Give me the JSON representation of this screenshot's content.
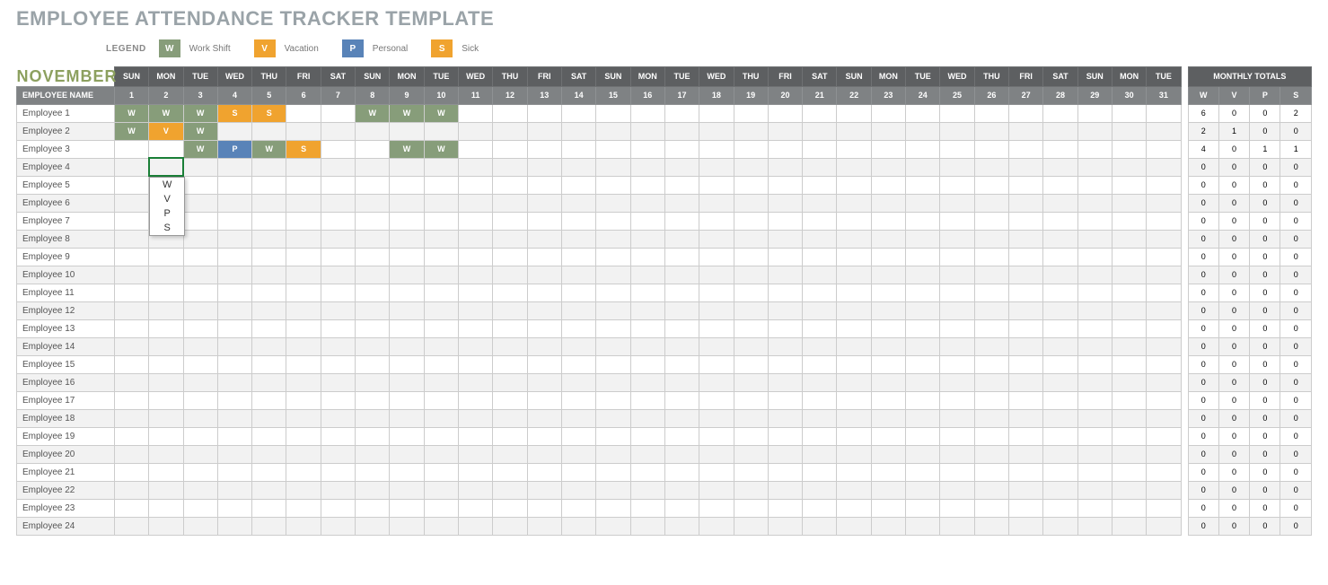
{
  "title": "EMPLOYEE ATTENDANCE TRACKER TEMPLATE",
  "legend": {
    "label": "LEGEND",
    "items": [
      {
        "code": "W",
        "text": "Work Shift"
      },
      {
        "code": "V",
        "text": "Vacation"
      },
      {
        "code": "P",
        "text": "Personal"
      },
      {
        "code": "S",
        "text": "Sick"
      }
    ]
  },
  "month": "NOVEMBER",
  "headers": {
    "employee_name": "EMPLOYEE NAME",
    "monthly_totals": "MONTHLY TOTALS",
    "days_of_week": [
      "SUN",
      "MON",
      "TUE",
      "WED",
      "THU",
      "FRI",
      "SAT",
      "SUN",
      "MON",
      "TUE",
      "WED",
      "THU",
      "FRI",
      "SAT",
      "SUN",
      "MON",
      "TUE",
      "WED",
      "THU",
      "FRI",
      "SAT",
      "SUN",
      "MON",
      "TUE",
      "WED",
      "THU",
      "FRI",
      "SAT",
      "SUN",
      "MON",
      "TUE"
    ],
    "day_numbers": [
      "1",
      "2",
      "3",
      "4",
      "5",
      "6",
      "7",
      "8",
      "9",
      "10",
      "11",
      "12",
      "13",
      "14",
      "15",
      "16",
      "17",
      "18",
      "19",
      "20",
      "21",
      "22",
      "23",
      "24",
      "25",
      "26",
      "27",
      "28",
      "29",
      "30",
      "31"
    ],
    "totals_cols": [
      "W",
      "V",
      "P",
      "S"
    ]
  },
  "employees": [
    {
      "name": "Employee 1",
      "days": {
        "1": "W",
        "2": "W",
        "3": "W",
        "4": "S",
        "5": "S",
        "8": "W",
        "9": "W",
        "10": "W"
      },
      "totals": [
        "6",
        "0",
        "0",
        "2"
      ]
    },
    {
      "name": "Employee 2",
      "days": {
        "1": "W",
        "2": "V",
        "3": "W"
      },
      "totals": [
        "2",
        "1",
        "0",
        "0"
      ]
    },
    {
      "name": "Employee 3",
      "days": {
        "3": "W",
        "4": "P",
        "5": "W",
        "6": "S",
        "9": "W",
        "10": "W"
      },
      "totals": [
        "4",
        "0",
        "1",
        "1"
      ]
    },
    {
      "name": "Employee 4",
      "days": {},
      "totals": [
        "0",
        "0",
        "0",
        "0"
      ],
      "selectedDay": 2
    },
    {
      "name": "Employee 5",
      "days": {},
      "totals": [
        "0",
        "0",
        "0",
        "0"
      ]
    },
    {
      "name": "Employee 6",
      "days": {},
      "totals": [
        "0",
        "0",
        "0",
        "0"
      ]
    },
    {
      "name": "Employee 7",
      "days": {},
      "totals": [
        "0",
        "0",
        "0",
        "0"
      ]
    },
    {
      "name": "Employee 8",
      "days": {},
      "totals": [
        "0",
        "0",
        "0",
        "0"
      ]
    },
    {
      "name": "Employee 9",
      "days": {},
      "totals": [
        "0",
        "0",
        "0",
        "0"
      ]
    },
    {
      "name": "Employee 10",
      "days": {},
      "totals": [
        "0",
        "0",
        "0",
        "0"
      ]
    },
    {
      "name": "Employee 11",
      "days": {},
      "totals": [
        "0",
        "0",
        "0",
        "0"
      ]
    },
    {
      "name": "Employee 12",
      "days": {},
      "totals": [
        "0",
        "0",
        "0",
        "0"
      ]
    },
    {
      "name": "Employee 13",
      "days": {},
      "totals": [
        "0",
        "0",
        "0",
        "0"
      ]
    },
    {
      "name": "Employee 14",
      "days": {},
      "totals": [
        "0",
        "0",
        "0",
        "0"
      ]
    },
    {
      "name": "Employee 15",
      "days": {},
      "totals": [
        "0",
        "0",
        "0",
        "0"
      ]
    },
    {
      "name": "Employee 16",
      "days": {},
      "totals": [
        "0",
        "0",
        "0",
        "0"
      ]
    },
    {
      "name": "Employee 17",
      "days": {},
      "totals": [
        "0",
        "0",
        "0",
        "0"
      ]
    },
    {
      "name": "Employee 18",
      "days": {},
      "totals": [
        "0",
        "0",
        "0",
        "0"
      ]
    },
    {
      "name": "Employee 19",
      "days": {},
      "totals": [
        "0",
        "0",
        "0",
        "0"
      ]
    },
    {
      "name": "Employee 20",
      "days": {},
      "totals": [
        "0",
        "0",
        "0",
        "0"
      ]
    },
    {
      "name": "Employee 21",
      "days": {},
      "totals": [
        "0",
        "0",
        "0",
        "0"
      ]
    },
    {
      "name": "Employee 22",
      "days": {},
      "totals": [
        "0",
        "0",
        "0",
        "0"
      ]
    },
    {
      "name": "Employee 23",
      "days": {},
      "totals": [
        "0",
        "0",
        "0",
        "0"
      ]
    },
    {
      "name": "Employee 24",
      "days": {},
      "totals": [
        "0",
        "0",
        "0",
        "0"
      ]
    }
  ],
  "dropdown": {
    "options": [
      "W",
      "V",
      "P",
      "S"
    ]
  }
}
